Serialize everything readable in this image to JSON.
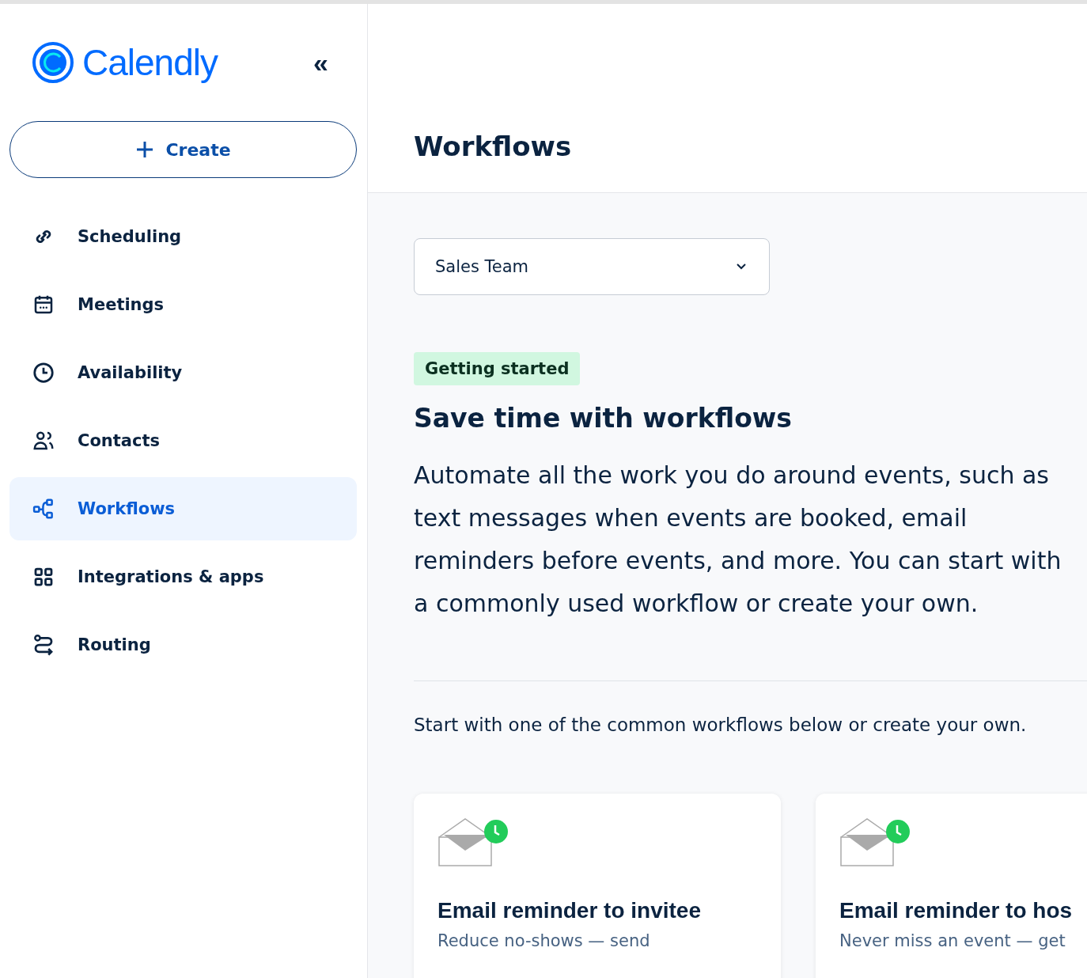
{
  "sidebar": {
    "logo": "Calendly",
    "collapse": "«",
    "create_button": "Create",
    "items": [
      {
        "label": "Scheduling",
        "selected": false
      },
      {
        "label": "Meetings",
        "selected": false
      },
      {
        "label": "Availability",
        "selected": false
      },
      {
        "label": "Contacts",
        "selected": false
      },
      {
        "label": "Workflows",
        "selected": true
      },
      {
        "label": "Integrations & apps",
        "selected": false
      },
      {
        "label": "Routing",
        "selected": false
      }
    ]
  },
  "header": {
    "title": "Workflows"
  },
  "team_select": {
    "value": "Sales Team"
  },
  "intro": {
    "badge": "Getting started",
    "heading": "Save time with workflows",
    "body": "Automate all the work you do around events, such as text messages when events are booked, email reminders before events, and more. You can start with a commonly used workflow or create your own."
  },
  "prompt": "Start with one of the common workflows below or create your own.",
  "cards": [
    {
      "title": "Email reminder to invitee",
      "description": "Reduce no-shows — send"
    },
    {
      "title": "Email reminder to hos",
      "description": "Never miss an event — get"
    }
  ]
}
